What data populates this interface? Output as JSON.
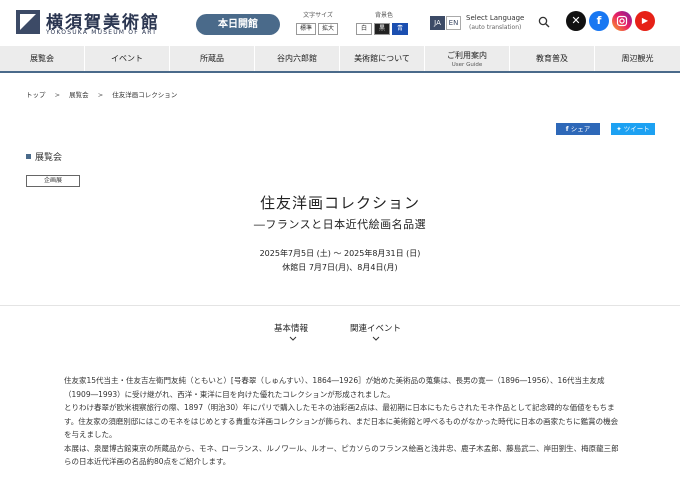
{
  "header": {
    "logo_jp": "横須賀美術館",
    "logo_en": "YOKOSUKA MUSEUM OF ART",
    "open_label": "本日開館",
    "fontsize": {
      "caption": "文字サイズ",
      "standard": "標準",
      "large": "拡大"
    },
    "bgcolor": {
      "caption": "背景色",
      "white": "白",
      "black": "黒",
      "blue": "青"
    },
    "lang": {
      "ja": "JA",
      "en": "EN",
      "select": "Select Language",
      "select_sub": "(auto translation)"
    },
    "icons": {
      "search": "search-icon",
      "x": "x-icon",
      "facebook": "facebook-icon",
      "instagram": "instagram-icon",
      "youtube": "youtube-icon"
    },
    "colors": {
      "brand": "#3c4a66",
      "accent": "#4a6a8a",
      "blue": "#1b4fb0"
    }
  },
  "nav": {
    "items": [
      {
        "label": "展覧会",
        "sub": ""
      },
      {
        "label": "イベント",
        "sub": ""
      },
      {
        "label": "所蔵品",
        "sub": ""
      },
      {
        "label": "谷内六郎館",
        "sub": ""
      },
      {
        "label": "美術館について",
        "sub": ""
      },
      {
        "label": "ご利用案内",
        "sub": "User Guide"
      },
      {
        "label": "教育普及",
        "sub": ""
      },
      {
        "label": "周辺観光",
        "sub": ""
      }
    ]
  },
  "breadcrumb": {
    "home": "トップ",
    "exhibitions": "展覧会",
    "current": "住友洋画コレクション"
  },
  "share": {
    "facebook": "シェア",
    "twitter": "ツイート"
  },
  "section_label": "展覧会",
  "tag": "企画展",
  "exhibition": {
    "title": "住友洋画コレクション",
    "subtitle": "―フランスと日本近代絵画名品選",
    "date": "2025年7月5日 (土) 〜 2025年8月31日 (日)",
    "closed": "休館日 7月7日(月)、8月4日(月)"
  },
  "tabs": {
    "basic": "基本情報",
    "event": "関連イベント"
  },
  "body": {
    "p1": "住友家15代当主・住友吉左衛門友純（ともいと）[号春翠（しゅんすい）、1864―1926］が始めた美術品の蒐集は、長男の寛一（1896―1956）、16代当主友成（1909―1993）に受け継がれ、西洋・東洋に目を向けた優れたコレクションが形成されました。",
    "p2": "とりわけ春翠が欧米視察旅行の際、1897（明治30）年にパリで購入したモネの油彩画2点は、最初期に日本にもたらされたモネ作品として記念碑的な価値をもちます。住友家の須磨別邸にはこのモネをはじめとする貴重な洋画コレクションが飾られ、まだ日本に美術館と呼べるものがなかった時代に日本の画家たちに鑑賞の機会を与えました。",
    "p3": "本展は、泉屋博古館東京の所蔵品から、モネ、ローランス、ルノワール、ルオー、ピカソらのフランス絵画と浅井忠、鹿子木孟郎、藤島武二、岸田劉生、梅原龍三郎らの日本近代洋画の名品約80点をご紹介します。"
  }
}
